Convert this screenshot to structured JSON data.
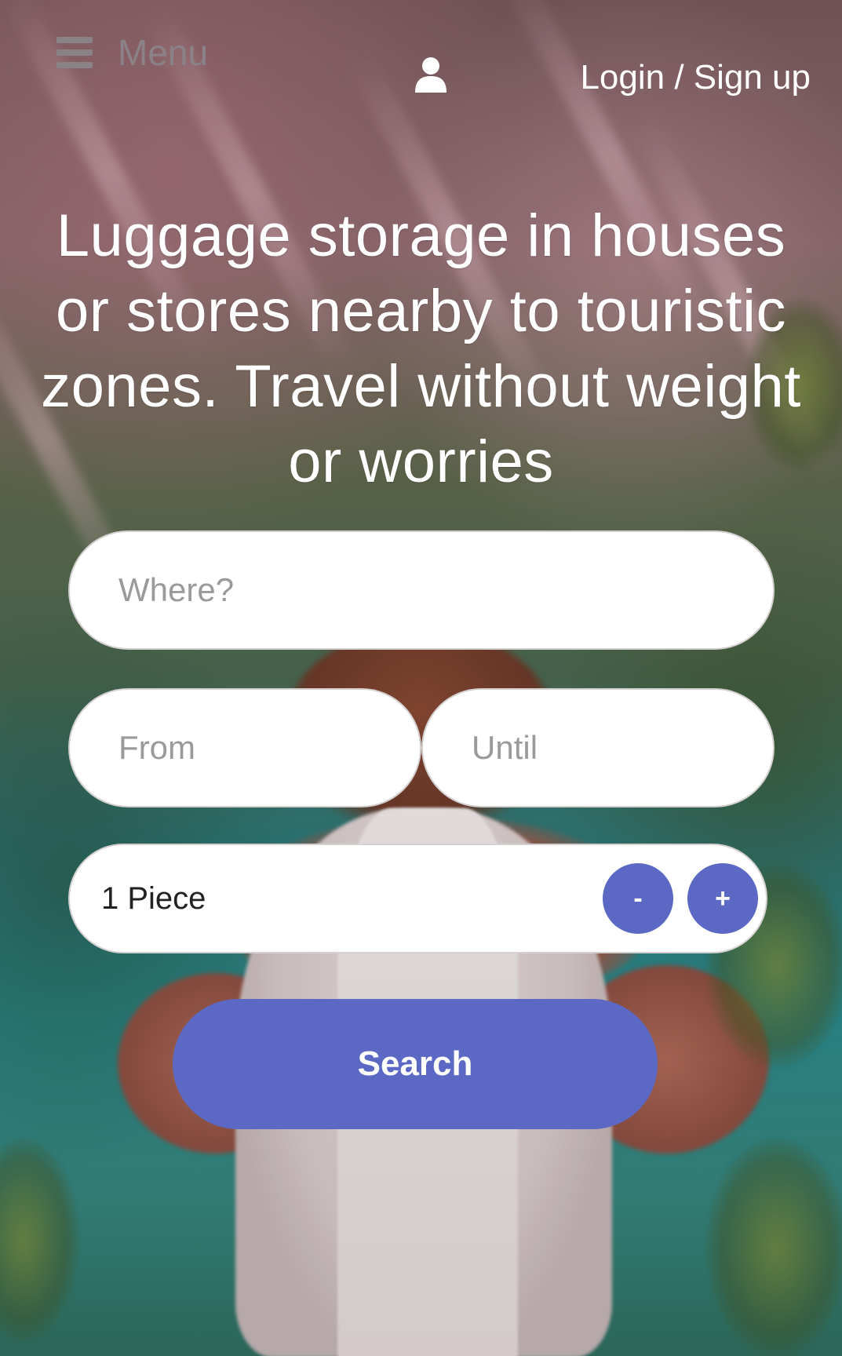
{
  "header": {
    "menu_label": "Menu",
    "menu_icon": "hamburger-icon",
    "user_icon": "user-icon",
    "login_label": "Login / Sign up"
  },
  "hero": {
    "headline": "Luggage storage in houses or stores nearby to touristic zones. Travel without weight or worries"
  },
  "search_form": {
    "where_placeholder": "Where?",
    "from_placeholder": "From",
    "until_placeholder": "Until",
    "pieces_value": "1 Piece",
    "decrement_label": "-",
    "increment_label": "+",
    "search_label": "Search"
  },
  "colors": {
    "accent": "#5b69c4",
    "text_light": "#ffffff",
    "menu_text": "#8b8287"
  }
}
